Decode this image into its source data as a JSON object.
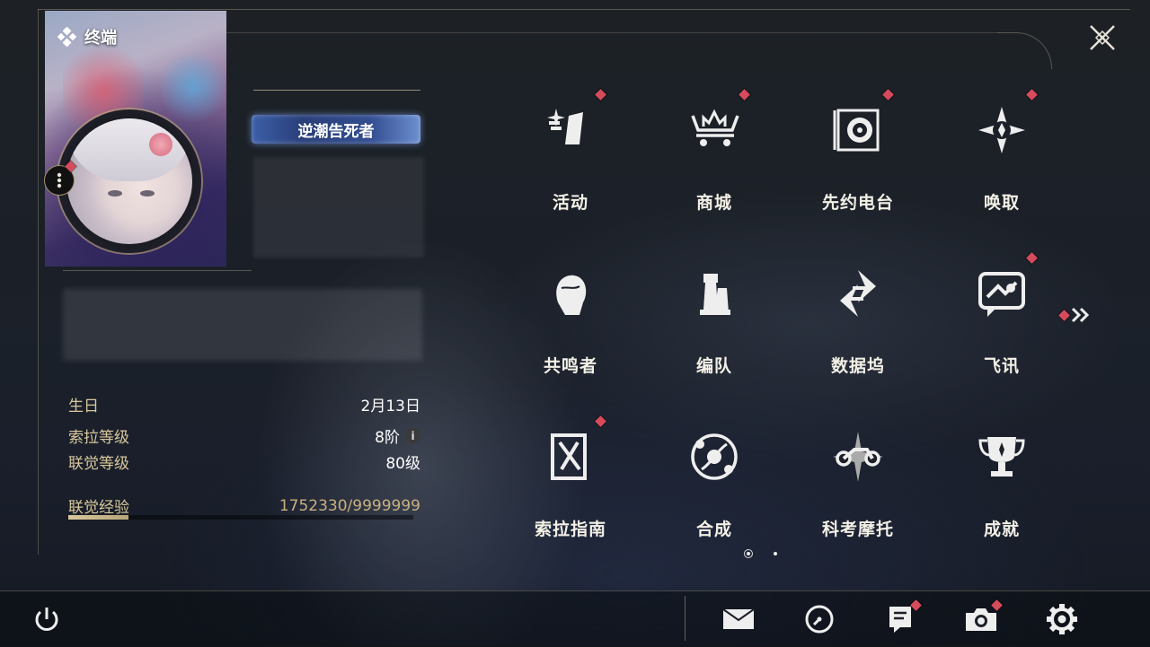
{
  "header": {
    "terminal_label": "终端"
  },
  "profile": {
    "title_badge": "逆潮告死者",
    "stats": {
      "birthday_label": "生日",
      "birthday_value": "2月13日",
      "sola_level_label": "索拉等级",
      "sola_level_value": "8阶",
      "union_level_label": "联觉等级",
      "union_level_value": "80级",
      "union_exp_label": "联觉经验",
      "union_exp_value": "1752330/9999999",
      "union_exp_progress": 0.1752
    }
  },
  "menu": {
    "items": [
      {
        "label": "活动",
        "icon": "sparkle-flag-icon",
        "has_badge": true
      },
      {
        "label": "商城",
        "icon": "crown-cart-icon",
        "has_badge": true
      },
      {
        "label": "先约电台",
        "icon": "radio-disc-icon",
        "has_badge": true
      },
      {
        "label": "唤取",
        "icon": "compass-star-icon",
        "has_badge": true
      },
      {
        "label": "共鸣者",
        "icon": "character-head-icon",
        "has_badge": false
      },
      {
        "label": "编队",
        "icon": "chess-pieces-icon",
        "has_badge": false
      },
      {
        "label": "数据坞",
        "icon": "data-dock-icon",
        "has_badge": false
      },
      {
        "label": "飞讯",
        "icon": "chat-bubble-icon",
        "has_badge": true
      },
      {
        "label": "索拉指南",
        "icon": "guide-book-icon",
        "has_badge": true
      },
      {
        "label": "合成",
        "icon": "synthesis-orbit-icon",
        "has_badge": false
      },
      {
        "label": "科考摩托",
        "icon": "motorcycle-icon",
        "has_badge": false
      },
      {
        "label": "成就",
        "icon": "trophy-icon",
        "has_badge": false
      }
    ],
    "pages": {
      "current": 1,
      "total": 2
    }
  },
  "bottom_bar": {
    "buttons": [
      "power-icon",
      "mail-icon",
      "clock-icon",
      "notice-icon",
      "camera-icon",
      "settings-gear-icon"
    ]
  },
  "colors": {
    "accent_gold": "#d9c89c",
    "badge_red": "#d64b5c",
    "text": "#f3f0e6"
  }
}
